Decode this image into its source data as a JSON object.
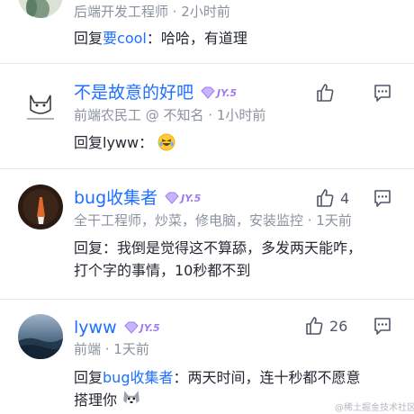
{
  "comments": [
    {
      "meta": "后端开发工程师 · 2小时前",
      "text_prefix": "回复",
      "mention": "要cool",
      "text_body": "：哈哈，有道理"
    },
    {
      "name": "不是故意的好吧",
      "level": "JY.5",
      "meta": "前端农民工 @ 不知名 · 1小时前",
      "text_prefix": "回复",
      "text_body": "lyww：",
      "emoji": "rofl-emoji"
    },
    {
      "name": "bug收集者",
      "level": "JY.5",
      "meta": "全干工程师，炒菜，修电脑，安装监控 · 1天前",
      "likes": "4",
      "text_lines": [
        "回复：我倒是觉得这不算舔，多发两天能咋，",
        "打个字的事情，10秒都不到"
      ]
    },
    {
      "name": "lyww",
      "level": "JY.5",
      "meta": "前端 · 1天前",
      "likes": "26",
      "text_prefix": "回复",
      "mention": "bug收集者",
      "text_body": "：两天时间，连十秒都不愿意",
      "text_line2": "搭理你",
      "emoji": "husky-dog-emoji"
    }
  ],
  "icons": {
    "like": "thumbs-up-icon",
    "reply": "comment-icon",
    "badge": "level-gem-icon"
  },
  "colors": {
    "name_link": "#1e6fff",
    "meta": "#8a919f",
    "badge": "#a07af0"
  },
  "watermark": "@稀土掘金技术社区"
}
